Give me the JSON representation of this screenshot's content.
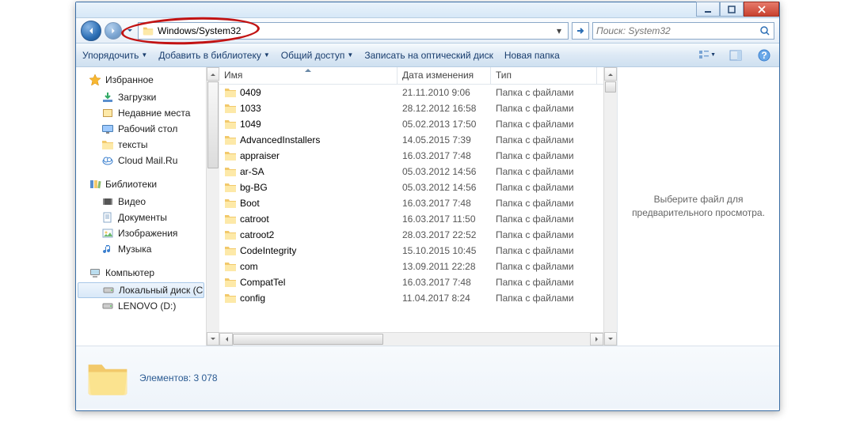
{
  "address": {
    "path": "Windows/System32"
  },
  "search": {
    "placeholder": "Поиск: System32"
  },
  "toolbar": {
    "organize": "Упорядочить",
    "add_library": "Добавить в библиотеку",
    "share": "Общий доступ",
    "burn": "Записать на оптический диск",
    "new_folder": "Новая папка"
  },
  "columns": {
    "name": "Имя",
    "date": "Дата изменения",
    "type": "Тип"
  },
  "sidebar": {
    "favorites": {
      "label": "Избранное",
      "items": [
        {
          "label": "Загрузки",
          "icon": "downloads"
        },
        {
          "label": "Недавние места",
          "icon": "recent"
        },
        {
          "label": "Рабочий стол",
          "icon": "desktop"
        },
        {
          "label": "тексты",
          "icon": "folder"
        },
        {
          "label": "Cloud Mail.Ru",
          "icon": "cloud"
        }
      ]
    },
    "libraries": {
      "label": "Библиотеки",
      "items": [
        {
          "label": "Видео",
          "icon": "video"
        },
        {
          "label": "Документы",
          "icon": "documents"
        },
        {
          "label": "Изображения",
          "icon": "images"
        },
        {
          "label": "Музыка",
          "icon": "music"
        }
      ]
    },
    "computer": {
      "label": "Компьютер",
      "items": [
        {
          "label": "Локальный диск (C",
          "icon": "drive",
          "selected": true
        },
        {
          "label": "LENOVO (D:)",
          "icon": "drive"
        }
      ]
    }
  },
  "files": [
    {
      "name": "0409",
      "date": "21.11.2010 9:06",
      "type": "Папка с файлами"
    },
    {
      "name": "1033",
      "date": "28.12.2012 16:58",
      "type": "Папка с файлами"
    },
    {
      "name": "1049",
      "date": "05.02.2013 17:50",
      "type": "Папка с файлами"
    },
    {
      "name": "AdvancedInstallers",
      "date": "14.05.2015 7:39",
      "type": "Папка с файлами"
    },
    {
      "name": "appraiser",
      "date": "16.03.2017 7:48",
      "type": "Папка с файлами"
    },
    {
      "name": "ar-SA",
      "date": "05.03.2012 14:56",
      "type": "Папка с файлами"
    },
    {
      "name": "bg-BG",
      "date": "05.03.2012 14:56",
      "type": "Папка с файлами"
    },
    {
      "name": "Boot",
      "date": "16.03.2017 7:48",
      "type": "Папка с файлами"
    },
    {
      "name": "catroot",
      "date": "16.03.2017 11:50",
      "type": "Папка с файлами"
    },
    {
      "name": "catroot2",
      "date": "28.03.2017 22:52",
      "type": "Папка с файлами"
    },
    {
      "name": "CodeIntegrity",
      "date": "15.10.2015 10:45",
      "type": "Папка с файлами"
    },
    {
      "name": "com",
      "date": "13.09.2011 22:28",
      "type": "Папка с файлами"
    },
    {
      "name": "CompatTel",
      "date": "16.03.2017 7:48",
      "type": "Папка с файлами"
    },
    {
      "name": "config",
      "date": "11.04.2017 8:24",
      "type": "Папка с файлами"
    }
  ],
  "preview": {
    "text": "Выберите файл для предварительного просмотра."
  },
  "status": {
    "label": "Элементов:",
    "count": "3 078"
  }
}
